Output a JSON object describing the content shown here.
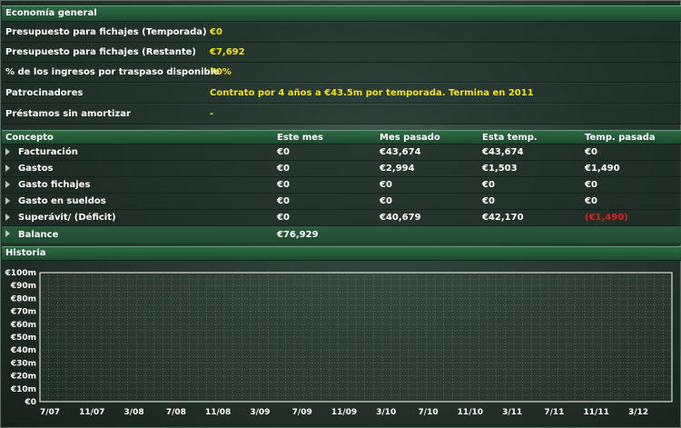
{
  "general": {
    "header": "Economía general",
    "rows": [
      {
        "label": "Presupuesto para fichajes (Temporada)",
        "value": "€0"
      },
      {
        "label": "Presupuesto para fichajes (Restante)",
        "value": "€7,692"
      },
      {
        "label": "% de los ingresos por traspaso disponible",
        "value": "70%"
      },
      {
        "label": "Patrocinadores",
        "value": "Contrato por 4 años a €43.5m por temporada. Termina en 2011"
      },
      {
        "label": "Préstamos sin amortizar",
        "value": "-"
      }
    ]
  },
  "table": {
    "columns": [
      "Concepto",
      "Este mes",
      "Mes pasado",
      "Esta temp.",
      "Temp. pasada"
    ],
    "rows": [
      {
        "name": "Facturación",
        "cells": [
          "€0",
          "€43,674",
          "€43,674",
          "€0"
        ]
      },
      {
        "name": "Gastos",
        "cells": [
          "€0",
          "€2,994",
          "€1,503",
          "€1,490"
        ]
      },
      {
        "name": "Gasto fichajes",
        "cells": [
          "€0",
          "€0",
          "€0",
          "€0"
        ]
      },
      {
        "name": "Gasto en sueldos",
        "cells": [
          "€0",
          "€0",
          "€0",
          "€0"
        ]
      },
      {
        "name": "Superávit/ (Déficit)",
        "cells": [
          "€0",
          "€40,679",
          "€42,170",
          "(€1,490)"
        ]
      },
      {
        "name": "Balance",
        "cells": [
          "€76,929",
          "",
          "",
          ""
        ]
      }
    ]
  },
  "history": {
    "header": "Historia"
  },
  "colors": {
    "value_yellow": "#f4e21a",
    "negative_red": "#e0201c",
    "header_green": "#2f6a45"
  },
  "chart_data": {
    "type": "line",
    "title": "",
    "xlabel": "",
    "ylabel": "",
    "x_ticks": [
      "7/07",
      "11/07",
      "3/08",
      "7/08",
      "11/08",
      "3/09",
      "7/09",
      "11/09",
      "3/10",
      "7/10",
      "11/10",
      "3/11",
      "7/11",
      "11/11",
      "3/12"
    ],
    "y_ticks": [
      "€0",
      "€10m",
      "€20m",
      "€30m",
      "€40m",
      "€50m",
      "€60m",
      "€70m",
      "€80m",
      "€90m",
      "€100m"
    ],
    "ylim": [
      0,
      100
    ],
    "grid": true,
    "series": []
  }
}
